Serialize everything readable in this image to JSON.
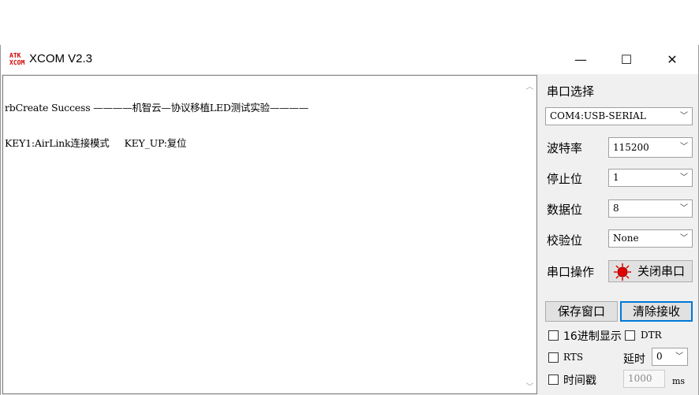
{
  "window": {
    "title": "XCOM V2.3",
    "icon_text_line1": "ATK",
    "icon_text_line2": "XCOM",
    "minimize": "—",
    "maximize": "☐",
    "close": "✕"
  },
  "receive": {
    "line1": "rbCreate Success ————机智云—协议移植LED测试实验————",
    "line2": "KEY1:AirLink连接模式     KEY_UP:复位"
  },
  "panel": {
    "port_select_label": "串口选择",
    "port_value": "COM4:USB-SERIAL",
    "baud_label": "波特率",
    "baud_value": "115200",
    "stopbits_label": "停止位",
    "stopbits_value": "1",
    "databits_label": "数据位",
    "databits_value": "8",
    "parity_label": "校验位",
    "parity_value": "None",
    "port_op_label": "串口操作",
    "close_port_button": "关闭串口",
    "save_window_button": "保存窗口",
    "clear_receive_button": "清除接收",
    "hex_display_label": "16进制显示",
    "dtr_label": "DTR",
    "rts_label": "RTS",
    "delay_label": "延时",
    "delay_value": "0",
    "timestamp_label": "时间戳",
    "timestamp_value": "1000",
    "timestamp_unit": "ms",
    "colors": {
      "led_red": "#e00000",
      "focus_blue": "#0078d7"
    }
  }
}
